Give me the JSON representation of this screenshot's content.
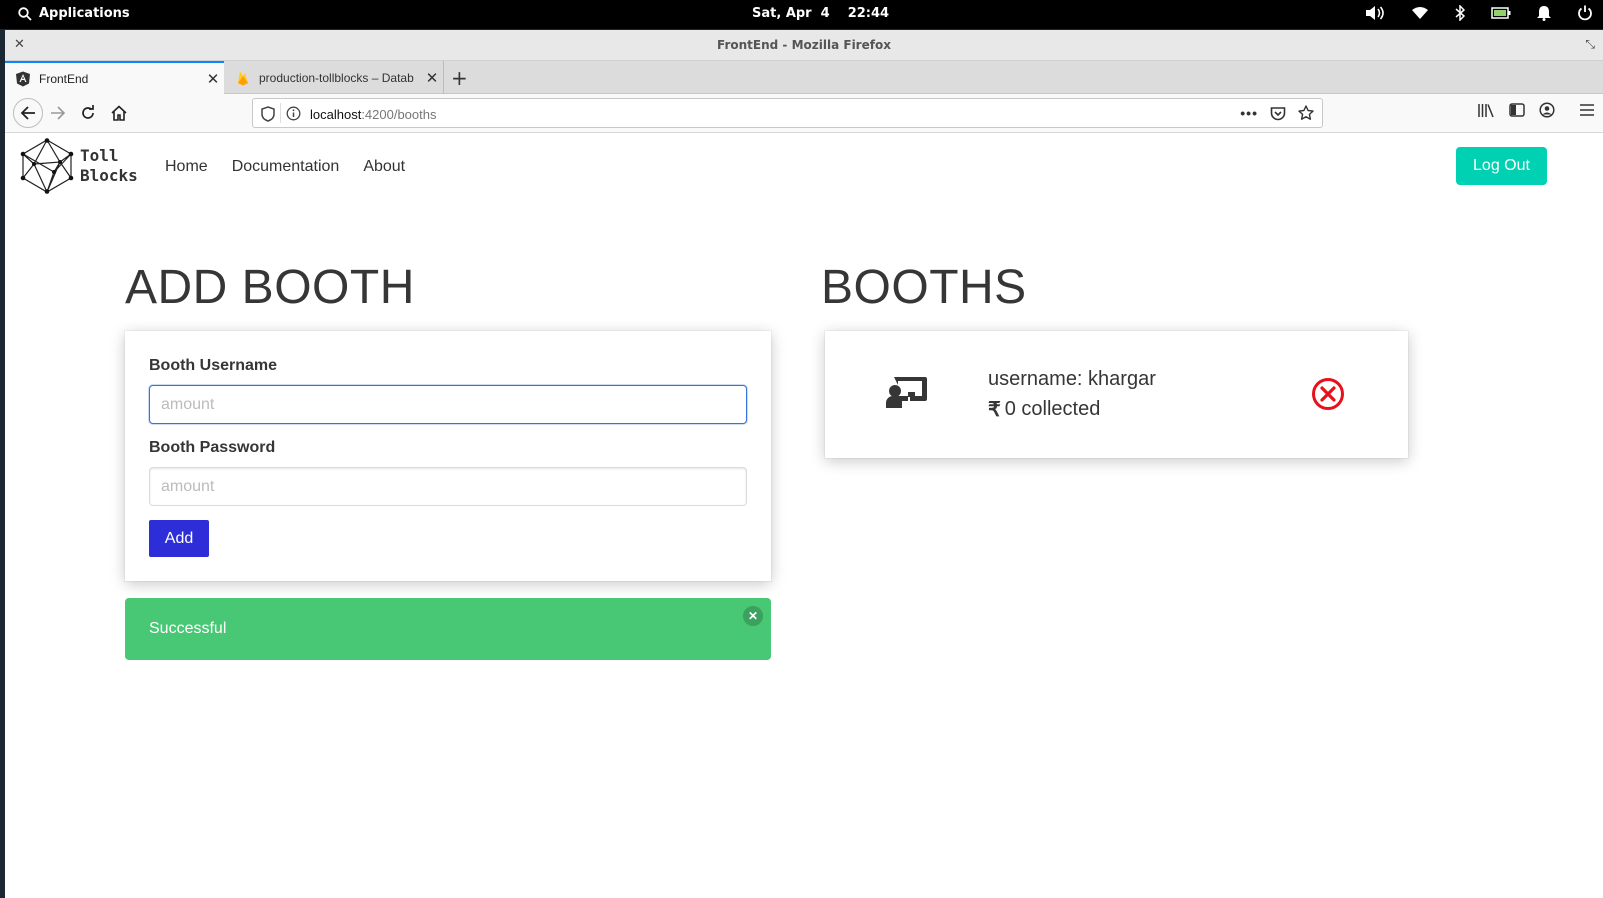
{
  "system_bar": {
    "applications_label": "Applications",
    "date": "Sat, Apr  4",
    "time": "22:44"
  },
  "window": {
    "title": "FrontEnd - Mozilla Firefox"
  },
  "tabs": [
    {
      "label": "FrontEnd",
      "favicon": "angular-icon"
    },
    {
      "label": "production-tollblocks – Datab",
      "favicon": "firebase-icon"
    }
  ],
  "urlbar": {
    "host": "localhost",
    "path": ":4200/booths"
  },
  "site": {
    "logo_line1": "Toll",
    "logo_line2": "Blocks",
    "nav": {
      "home": "Home",
      "documentation": "Documentation",
      "about": "About"
    },
    "logout_label": "Log Out"
  },
  "add_booth": {
    "heading": "ADD BOOTH",
    "username_label": "Booth Username",
    "username_placeholder": "amount",
    "password_label": "Booth Password",
    "password_placeholder": "amount",
    "add_label": "Add"
  },
  "notification": {
    "text": "Successful",
    "close": "✕",
    "color": "#48c774"
  },
  "booths": {
    "heading": "BOOTHS",
    "items": [
      {
        "username": "username: khargar",
        "currency": "₹",
        "collected": "0 collected"
      }
    ]
  },
  "colors": {
    "logout": "#00d1b2",
    "add_button": "#2e2ed9",
    "delete_icon": "#e8101a"
  }
}
